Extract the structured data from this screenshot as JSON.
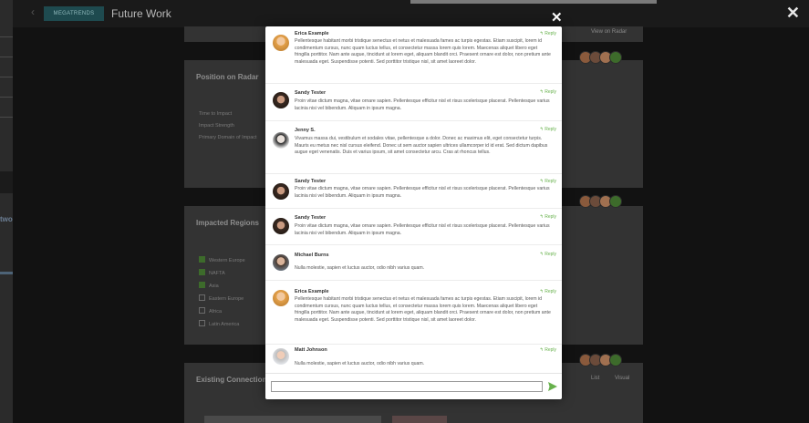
{
  "app": {
    "brand": "MEGATRENDS",
    "title": "Future Work"
  },
  "background": {
    "left_fragment": "two",
    "view_on_radar": "View on Radar",
    "position_panel": {
      "title": "Position on Radar",
      "rows": [
        "Time to Impact",
        "Impact Strength",
        "Primary Domain of Impact"
      ]
    },
    "regions_panel": {
      "title": "Impacted Regions",
      "regions": [
        {
          "label": "Western Europe",
          "checked": true
        },
        {
          "label": "NAFTA",
          "checked": true
        },
        {
          "label": "Asia",
          "checked": true
        },
        {
          "label": "Eastern Europe",
          "checked": false
        },
        {
          "label": "Africa",
          "checked": false
        },
        {
          "label": "Latin America",
          "checked": false
        }
      ]
    },
    "connections_panel": {
      "title": "Existing Connections",
      "tabs": [
        "List",
        "Visual"
      ]
    }
  },
  "comments": [
    {
      "author": "Erica Example",
      "reply": "Reply",
      "avatar": "woman-blonde",
      "text": "Pellentesque habitant morbi tristique senectus et netus et malesuada fames ac turpis egestas. Etiam suscipit, lorem id condimentum cursus, nunc quam luctus tellus, et consectetur massa lorem quis lorem. Maecenas aliquet libero eget fringilla porttitor. Nam ante augue, tincidunt at lorem eget, aliquam blandit orci. Praesent ornare est dolor, non pretium ante malesuada eget. Suspendisse potenti. Sed porttitor tristique nisl, sit amet laoreet dolor."
    },
    {
      "author": "Sandy Tester",
      "reply": "Reply",
      "avatar": "woman-dark",
      "text": "Proin vitae dictum magna, vitae ornare sapien. Pellentesque efficitur nisl et risus scelerisque placerat. Pellentesque varius lacinia nisi vel bibendum. Aliquam in ipsum magna."
    },
    {
      "author": "Jenny S.",
      "reply": "Reply",
      "avatar": "woman-bw",
      "text": "Vivamus massa dui, vestibulum et sodales vitae, pellentesque a dolor. Donec ac maximus elit, eget consectetur turpis. Mauris eu metus nec nisl cursus eleifend. Donec ut sem auctor sapien ultrices ullamcorper id id erat. Sed dictum dapibus augue eget venenatis. Duis et varius ipsum, sit amet consectetur arcu. Cras at rhoncus tellus."
    },
    {
      "author": "Sandy Tester",
      "reply": "Reply",
      "avatar": "woman-dark",
      "text": "Proin vitae dictum magna, vitae ornare sapien. Pellentesque efficitur nisl et risus scelerisque placerat. Pellentesque varius lacinia nisi vel bibendum. Aliquam in ipsum magna."
    },
    {
      "author": "Sandy Tester",
      "reply": "Reply",
      "avatar": "woman-dark",
      "text": "Proin vitae dictum magna, vitae ornare sapien. Pellentesque efficitur nisl et risus scelerisque placerat. Pellentesque varius lacinia nisi vel bibendum. Aliquam in ipsum magna."
    },
    {
      "author": "Michael Burns",
      "reply": "Reply",
      "avatar": "man-beard",
      "text": "Nulla molestie, sapien et luctus auctor, odio nibh varius quam."
    },
    {
      "author": "Erica Example",
      "reply": "Reply",
      "avatar": "woman-blonde",
      "text": "Pellentesque habitant morbi tristique senectus et netus et malesuada fames ac turpis egestas. Etiam suscipit, lorem id condimentum cursus, nunc quam luctus tellus, et consectetur massa lorem quis lorem. Maecenas aliquet libero eget fringilla porttitor. Nam ante augue, tincidunt at lorem eget, aliquam blandit orci. Praesent ornare est dolor, non pretium ante malesuada eget. Suspendisse potenti. Sed porttitor tristique nisl, sit amet laoreet dolor."
    },
    {
      "author": "Matt Johnson",
      "reply": "Reply",
      "avatar": "man-grey",
      "text": "Nulla molestie, sapien et luctus auctor, odio nibh varius quam."
    }
  ],
  "composer": {
    "value": "",
    "placeholder": ""
  },
  "colors": {
    "accent_green": "#67b14c",
    "brand_teal": "#1e4a4f"
  },
  "icons": {
    "close": "close-icon",
    "send": "send-icon",
    "reply": "reply-icon",
    "info": "info-icon"
  }
}
